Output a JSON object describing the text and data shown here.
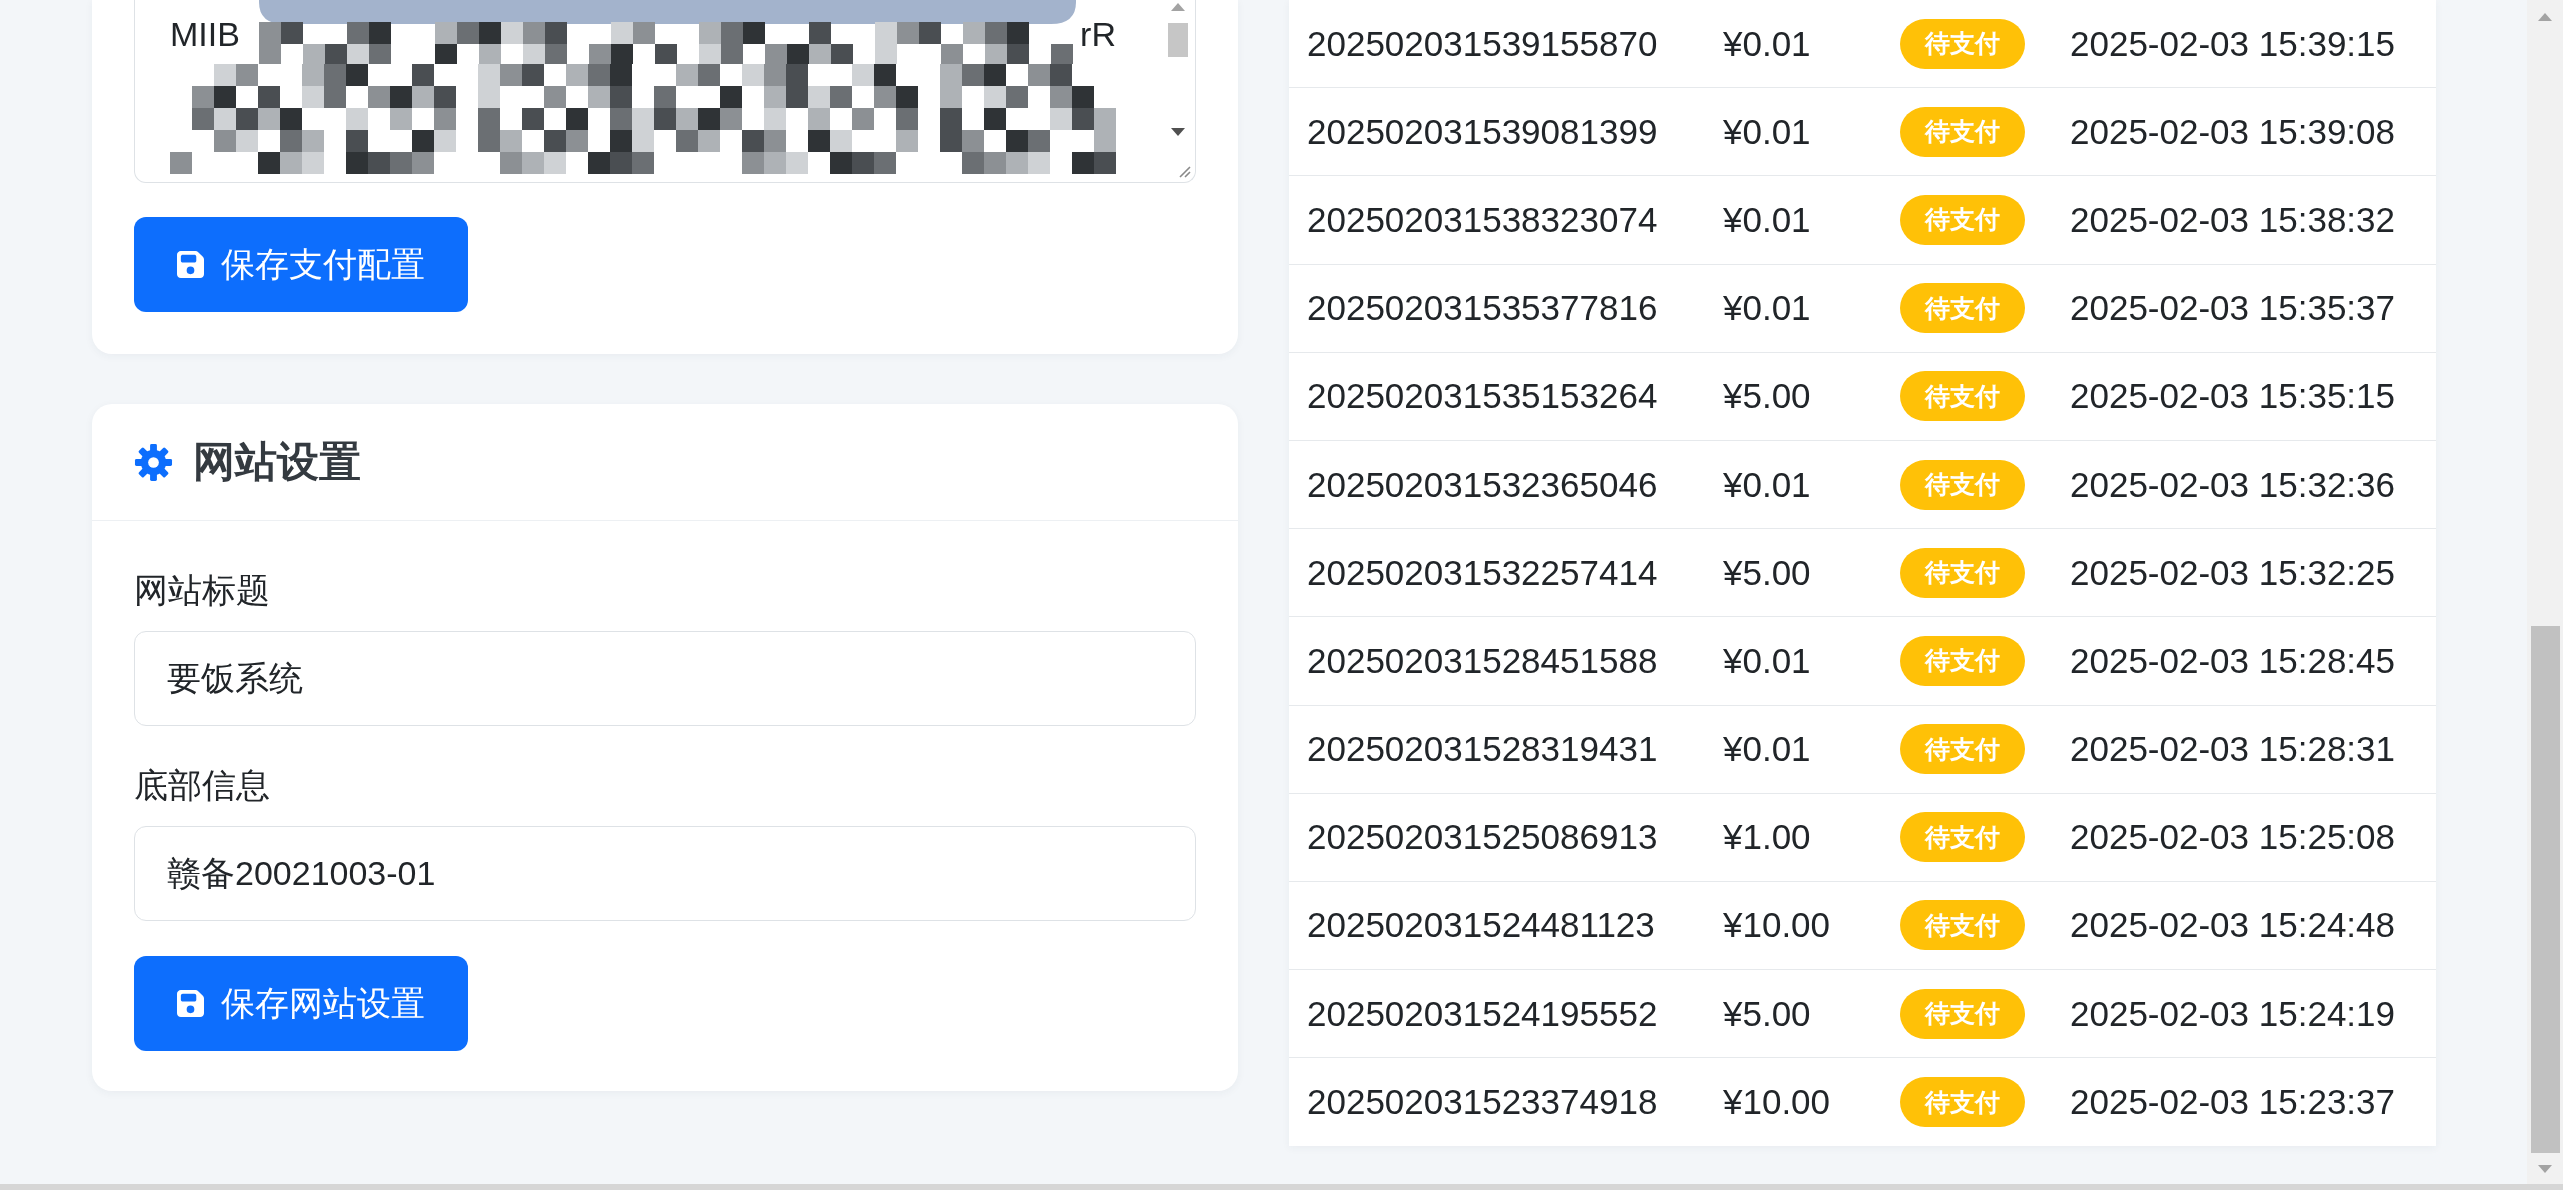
{
  "payment_config": {
    "key_textarea": {
      "visible_start": "MIIB",
      "visible_end": "rR",
      "redacted": true
    },
    "save_button": "保存支付配置"
  },
  "site_settings": {
    "title": "网站设置",
    "fields": [
      {
        "label": "网站标题",
        "value": "要饭系统"
      },
      {
        "label": "底部信息",
        "value": "赣备20021003-01"
      }
    ],
    "save_button": "保存网站设置"
  },
  "orders": {
    "rows": [
      {
        "order_no": "202502031539155870",
        "amount": "¥0.01",
        "status": "待支付",
        "time": "2025-02-03 15:39:15"
      },
      {
        "order_no": "202502031539081399",
        "amount": "¥0.01",
        "status": "待支付",
        "time": "2025-02-03 15:39:08"
      },
      {
        "order_no": "202502031538323074",
        "amount": "¥0.01",
        "status": "待支付",
        "time": "2025-02-03 15:38:32"
      },
      {
        "order_no": "202502031535377816",
        "amount": "¥0.01",
        "status": "待支付",
        "time": "2025-02-03 15:35:37"
      },
      {
        "order_no": "202502031535153264",
        "amount": "¥5.00",
        "status": "待支付",
        "time": "2025-02-03 15:35:15"
      },
      {
        "order_no": "202502031532365046",
        "amount": "¥0.01",
        "status": "待支付",
        "time": "2025-02-03 15:32:36"
      },
      {
        "order_no": "202502031532257414",
        "amount": "¥5.00",
        "status": "待支付",
        "time": "2025-02-03 15:32:25"
      },
      {
        "order_no": "202502031528451588",
        "amount": "¥0.01",
        "status": "待支付",
        "time": "2025-02-03 15:28:45"
      },
      {
        "order_no": "202502031528319431",
        "amount": "¥0.01",
        "status": "待支付",
        "time": "2025-02-03 15:28:31"
      },
      {
        "order_no": "202502031525086913",
        "amount": "¥1.00",
        "status": "待支付",
        "time": "2025-02-03 15:25:08"
      },
      {
        "order_no": "202502031524481123",
        "amount": "¥10.00",
        "status": "待支付",
        "time": "2025-02-03 15:24:48"
      },
      {
        "order_no": "202502031524195552",
        "amount": "¥5.00",
        "status": "待支付",
        "time": "2025-02-03 15:24:19"
      },
      {
        "order_no": "202502031523374918",
        "amount": "¥10.00",
        "status": "待支付",
        "time": "2025-02-03 15:23:37"
      }
    ]
  }
}
